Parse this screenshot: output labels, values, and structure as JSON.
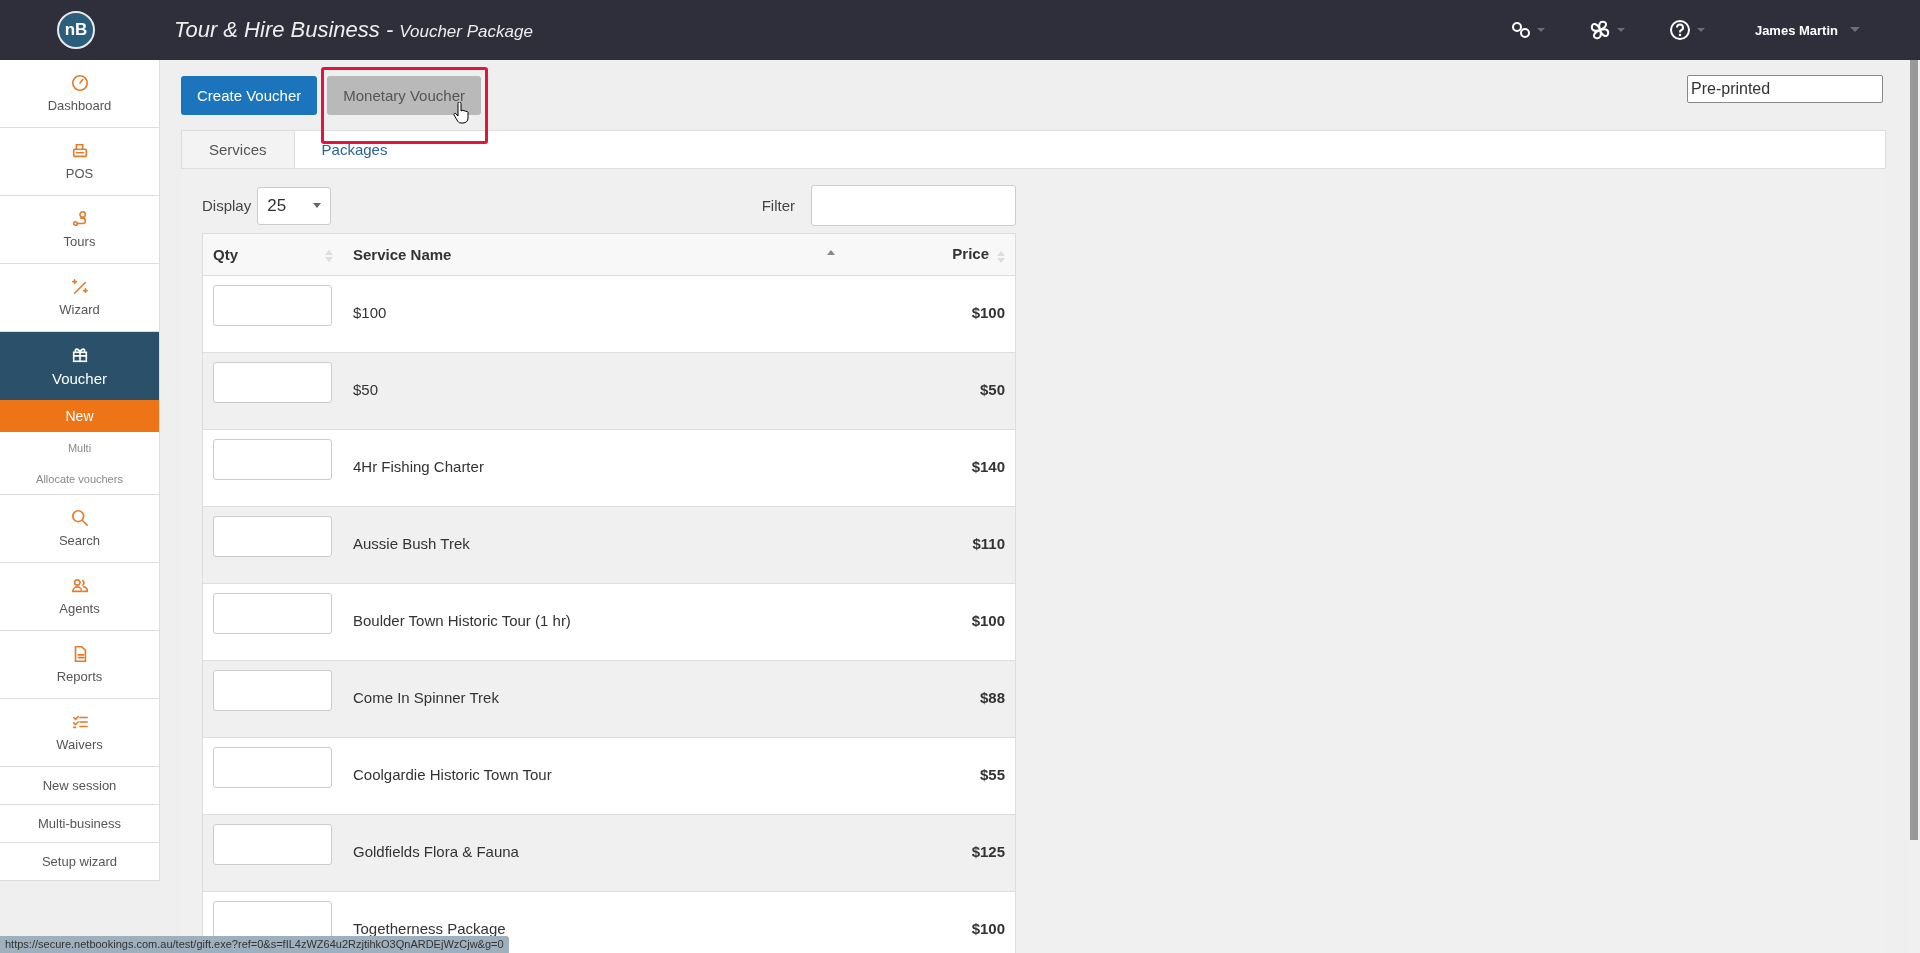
{
  "header": {
    "logo": "nB",
    "title": "Tour & Hire Business -",
    "subtitle": "Voucher Package",
    "user": "James Martin"
  },
  "sidebar": {
    "items": [
      {
        "kind": "main",
        "label": "Dashboard",
        "selected": false
      },
      {
        "kind": "main",
        "label": "POS",
        "selected": false
      },
      {
        "kind": "main",
        "label": "Tours",
        "selected": false
      },
      {
        "kind": "main",
        "label": "Wizard",
        "selected": false
      },
      {
        "kind": "main",
        "label": "Voucher",
        "selected": true,
        "children": [
          {
            "label": "New",
            "selected": true
          },
          {
            "label": "Multi",
            "selected": false
          },
          {
            "label": "Allocate vouchers",
            "selected": false
          }
        ]
      },
      {
        "kind": "main",
        "label": "Search",
        "selected": false
      },
      {
        "kind": "main",
        "label": "Agents",
        "selected": false
      },
      {
        "kind": "main",
        "label": "Reports",
        "selected": false
      },
      {
        "kind": "main",
        "label": "Waivers",
        "selected": false
      },
      {
        "kind": "link",
        "label": "New session",
        "selected": false
      },
      {
        "kind": "link",
        "label": "Multi-business",
        "selected": false
      },
      {
        "kind": "link",
        "label": "Setup wizard",
        "selected": false
      }
    ]
  },
  "toolbar": {
    "buttons": [
      {
        "label": "Create Voucher",
        "kind": "primary",
        "highlighted": false
      },
      {
        "label": "Monetary Voucher",
        "kind": "secondary",
        "highlighted": true
      }
    ],
    "voucher_type": "Pre-printed"
  },
  "tabs": [
    {
      "label": "Services",
      "selected": true
    },
    {
      "label": "Packages",
      "selected": false
    }
  ],
  "table": {
    "display_label": "Display",
    "page_size": "25",
    "filter_label": "Filter",
    "columns": [
      {
        "label": "Qty",
        "sorted": false
      },
      {
        "label": "Service Name",
        "sorted": true
      },
      {
        "label": "Price",
        "sorted": false
      }
    ],
    "rows": [
      {
        "name": "$100",
        "price": "$100"
      },
      {
        "name": "$50",
        "price": "$50"
      },
      {
        "name": "4Hr Fishing Charter",
        "price": "$140"
      },
      {
        "name": "Aussie Bush Trek",
        "price": "$110"
      },
      {
        "name": "Boulder Town Historic Tour (1 hr)",
        "price": "$100"
      },
      {
        "name": "Come In Spinner Trek",
        "price": "$88"
      },
      {
        "name": "Coolgardie Historic Town Tour",
        "price": "$55"
      },
      {
        "name": "Goldfields Flora & Fauna",
        "price": "$125"
      },
      {
        "name": "Togetherness Package",
        "price": "$100"
      }
    ]
  },
  "status_bar": "https://secure.netbookings.com.au/test/gift.exe?ref=0&s=fIL4zWZ64u2RzjtihkO3QnARDEjWzCjw&g=0"
}
